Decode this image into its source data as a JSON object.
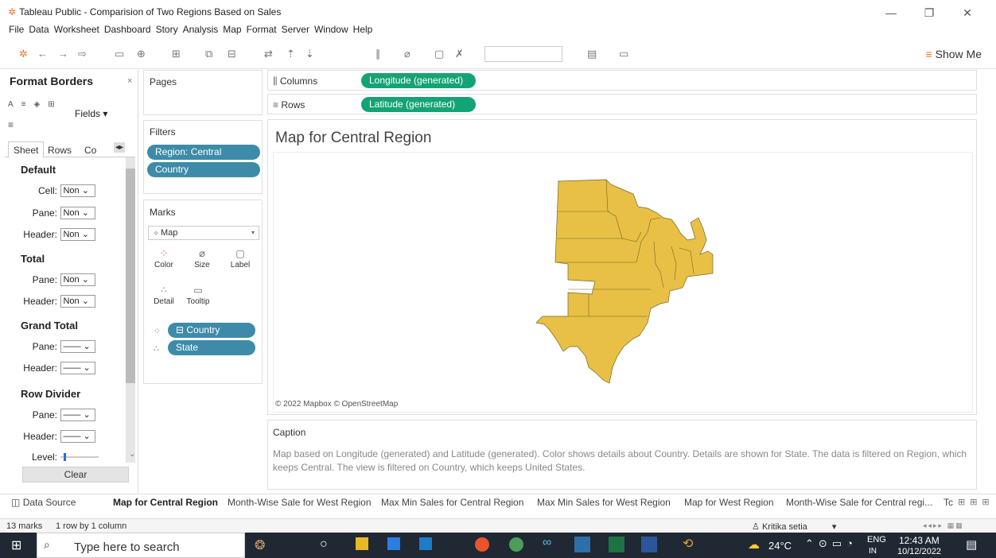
{
  "window": {
    "title": "Tableau Public - Comparision of Two Regions Based on Sales"
  },
  "menu": [
    "File",
    "Data",
    "Worksheet",
    "Dashboard",
    "Story",
    "Analysis",
    "Map",
    "Format",
    "Server",
    "Window",
    "Help"
  ],
  "toolbar": {
    "show_me": "Show Me"
  },
  "format_pane": {
    "title": "Format Borders",
    "fields_label": "Fields",
    "tabs": [
      "Sheet",
      "Rows",
      "Co"
    ],
    "default_label": "Default",
    "cell_label": "Cell:",
    "pane_label": "Pane:",
    "header_label": "Header:",
    "none_value": "Non",
    "total_label": "Total",
    "grand_total_label": "Grand Total",
    "row_divider_label": "Row Divider",
    "level_label": "Level:",
    "clear_label": "Clear"
  },
  "pages": {
    "title": "Pages"
  },
  "filters": {
    "title": "Filters",
    "items": [
      "Region: Central",
      "Country"
    ]
  },
  "marks": {
    "title": "Marks",
    "type": "Map",
    "buttons": [
      "Color",
      "Size",
      "Label",
      "Detail",
      "Tooltip"
    ],
    "pills": [
      "Country",
      "State"
    ]
  },
  "shelves": {
    "columns_label": "Columns",
    "rows_label": "Rows",
    "columns_pill": "Longitude (generated)",
    "rows_pill": "Latitude (generated)"
  },
  "view": {
    "title": "Map for Central Region",
    "attribution": "© 2022 Mapbox © OpenStreetMap",
    "caption_title": "Caption",
    "caption_text": "Map based on Longitude (generated) and Latitude (generated). Color shows details about Country. Details are shown for State. The data is filtered on Region, which keeps Central. The view is filtered on Country, which keeps United States.",
    "fill_color": "#e8c046"
  },
  "sheet_tabs": {
    "data_source": "Data Source",
    "items": [
      "Map for Central Region",
      "Month-Wise Sale for West Region",
      "Max Min Sales for Central Region",
      "Max Min Sales for West Region",
      "Map for West Region",
      "Month-Wise Sale for Central regi...",
      "Tc"
    ]
  },
  "status": {
    "marks": "13 marks",
    "grid": "1 row by 1 column",
    "user": "Kritika setia"
  },
  "taskbar": {
    "search_placeholder": "Type here to search",
    "temp": "24°C",
    "lang": "ENG",
    "region": "IN",
    "time": "12:43 AM",
    "date": "10/12/2022"
  }
}
